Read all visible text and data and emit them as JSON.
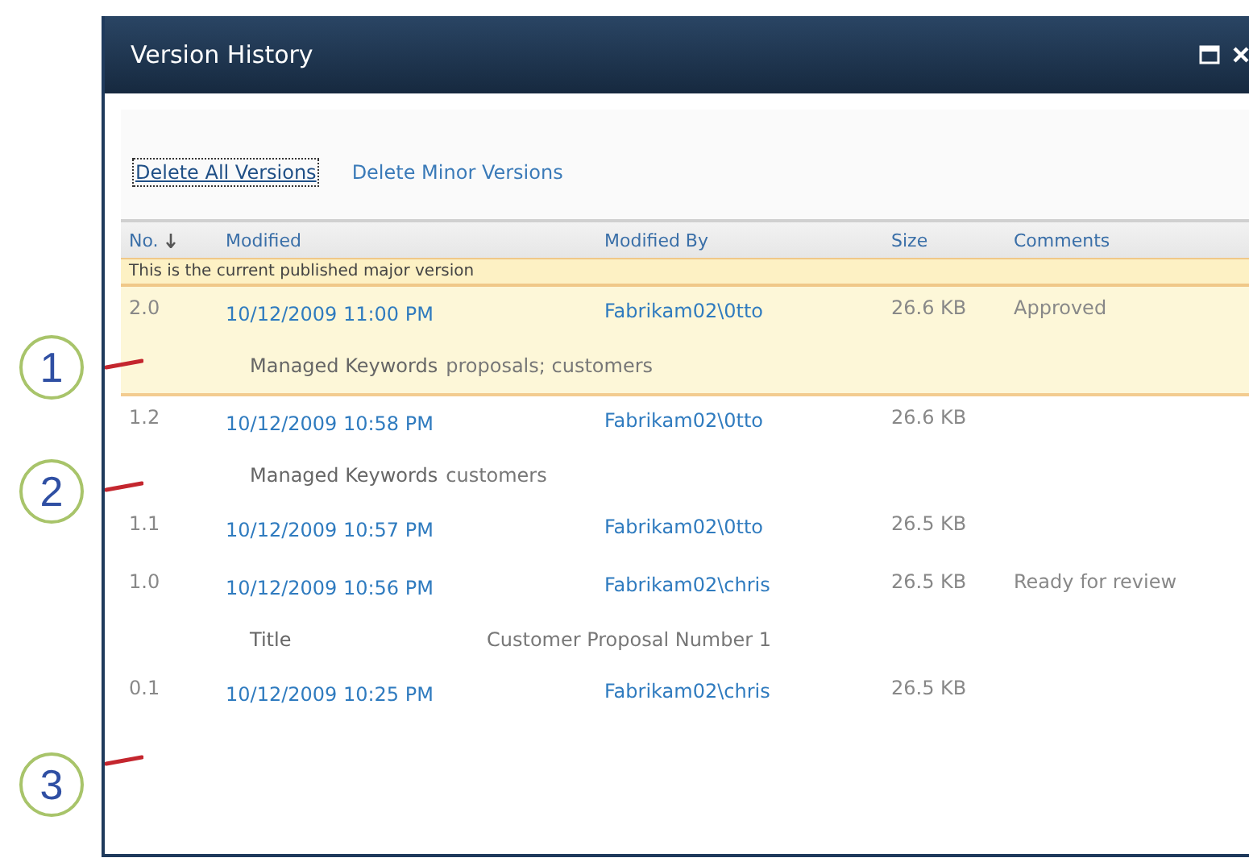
{
  "window": {
    "title": "Version History"
  },
  "actions": [
    {
      "label": "Delete All Versions",
      "focused": true
    },
    {
      "label": "Delete Minor Versions",
      "focused": false
    }
  ],
  "table": {
    "columns": [
      "No.",
      "Modified",
      "Modified By",
      "Size",
      "Comments"
    ],
    "banner": "This is the current published major version",
    "rows": [
      {
        "no": "2.0",
        "modified": "10/12/2009 11:00 PM",
        "modified_by": "Fabrikam02\\0tto",
        "size": "26.6 KB",
        "comments": "Approved",
        "current": true,
        "detail": {
          "kind": "inline",
          "label": "Managed Keywords",
          "value": "proposals; customers"
        }
      },
      {
        "no": "1.2",
        "modified": "10/12/2009 10:58 PM",
        "modified_by": "Fabrikam02\\0tto",
        "size": "26.6 KB",
        "current": false,
        "detail": {
          "kind": "inline",
          "label": "Managed Keywords",
          "value": "customers"
        }
      },
      {
        "no": "1.1",
        "modified": "10/12/2009 10:57 PM",
        "modified_by": "Fabrikam02\\0tto",
        "size": "26.5 KB",
        "current": false
      },
      {
        "no": "1.0",
        "modified": "10/12/2009 10:56 PM",
        "modified_by": "Fabrikam02\\chris",
        "size": "26.5 KB",
        "comments": "Ready for review",
        "current": false,
        "detail": {
          "kind": "columns",
          "label": "Title",
          "value": "Customer Proposal Number 1"
        }
      },
      {
        "no": "0.1",
        "modified": "10/12/2009 10:25 PM",
        "modified_by": "Fabrikam02\\chris",
        "size": "26.5 KB",
        "current": false
      }
    ]
  },
  "callouts": [
    "1",
    "2",
    "3"
  ]
}
